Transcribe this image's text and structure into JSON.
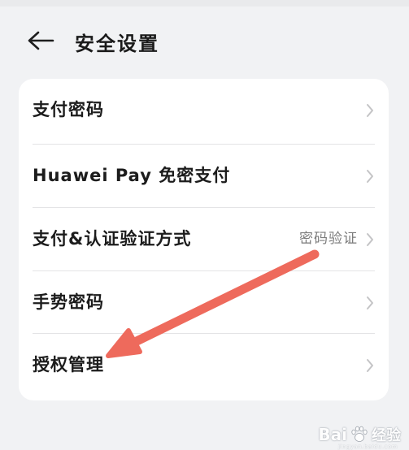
{
  "header": {
    "title": "安全设置",
    "back_icon": "back-arrow-icon"
  },
  "settings": {
    "items": [
      {
        "label": "支付密码",
        "value": ""
      },
      {
        "label": "Huawei Pay 免密支付",
        "value": ""
      },
      {
        "label": "支付&认证验证方式",
        "value": "密码验证"
      },
      {
        "label": "手势密码",
        "value": ""
      },
      {
        "label": "授权管理",
        "value": ""
      }
    ],
    "chevron_icon": "chevron-right-icon"
  },
  "annotation": {
    "arrow_color": "#ee6a5c",
    "points_to": "授权管理"
  },
  "watermark": {
    "brand": "Bai",
    "brand_tail": "经验",
    "url": "jingyan.baidu.com"
  },
  "colors": {
    "background": "#f1f2f4",
    "card": "#ffffff",
    "text": "#1c1c1c",
    "secondary_text": "#7b7b7b",
    "divider": "#e4e4e6"
  }
}
